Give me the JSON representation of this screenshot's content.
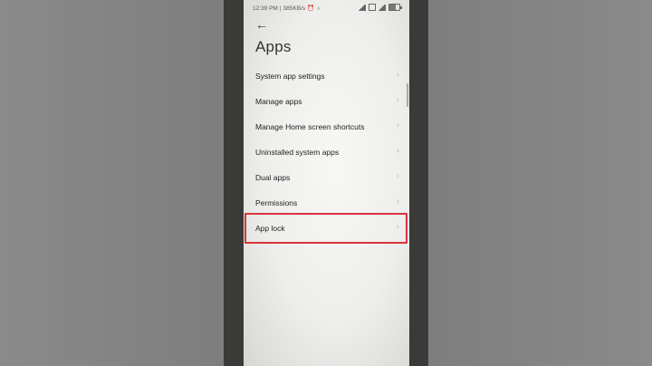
{
  "status_bar": {
    "time": "12:39 PM",
    "data_speed": "385KB/s",
    "battery_fill": 0.6
  },
  "page": {
    "title": "Apps"
  },
  "menu": {
    "items": [
      {
        "label": "System app settings"
      },
      {
        "label": "Manage apps"
      },
      {
        "label": "Manage Home screen shortcuts"
      },
      {
        "label": "Uninstalled system apps"
      },
      {
        "label": "Dual apps"
      },
      {
        "label": "Permissions"
      },
      {
        "label": "App lock"
      }
    ]
  },
  "icons": {
    "back": "arrow-left-icon",
    "chevron": "chevron-right-icon"
  },
  "colors": {
    "highlight_border": "#d8343a",
    "screen_bg": "#f7f7f5",
    "bezel": "#3a3a38"
  }
}
